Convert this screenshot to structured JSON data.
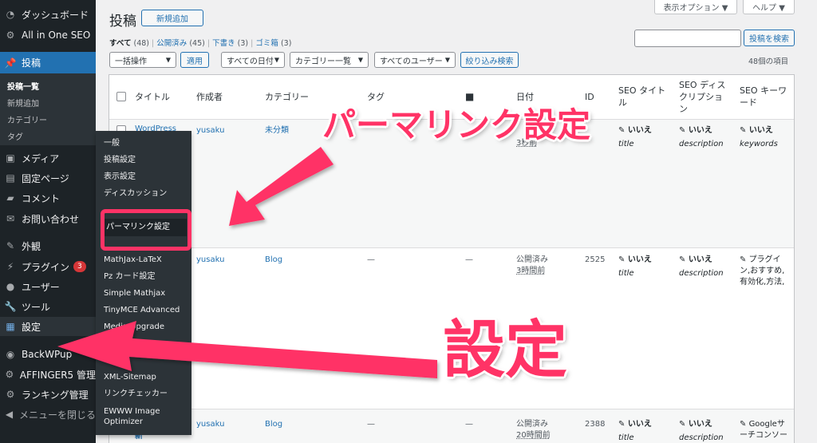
{
  "sidebar": {
    "dashboard": "ダッシュボード",
    "aioseo": "All in One SEO",
    "posts": "投稿",
    "posts_sub": [
      "投稿一覧",
      "新規追加",
      "カテゴリー",
      "タグ"
    ],
    "media": "メディア",
    "pages": "固定ページ",
    "comments": "コメント",
    "contact": "お問い合わせ",
    "appearance": "外観",
    "plugins": "プラグイン",
    "plugins_badge": "3",
    "users": "ユーザー",
    "tools": "ツール",
    "settings": "設定",
    "backwpup": "BackWPup",
    "affinger": "AFFINGER5 管理",
    "ranking": "ランキング管理",
    "collapse": "メニューを閉じる"
  },
  "flyout": {
    "items": [
      "一般",
      "投稿設定",
      "表示設定",
      "ディスカッション",
      "パーマリンク設定",
      "MathJax-LaTeX",
      "Pz カード設定",
      "Simple Mathjax",
      "TinyMCE Advanced",
      "Media Upgrade",
      "",
      "XML-Sitemap",
      "リンクチェッカー",
      "EWWW Image",
      "Optimizer"
    ]
  },
  "header": {
    "title": "投稿",
    "add_new": "新規追加",
    "screen_options": "表示オプション ▼",
    "help": "ヘルプ ▼",
    "filters": {
      "all": "すべて",
      "all_count": "(48)",
      "published": "公開済み",
      "published_count": "(45)",
      "draft": "下書き",
      "draft_count": "(3)",
      "trash": "ゴミ箱",
      "trash_count": "(3)"
    },
    "search_button": "投稿を検索",
    "search_value": "",
    "bulk_action": "一括操作",
    "apply": "適用",
    "date_filter": "すべての日付",
    "category_filter": "カテゴリー一覧",
    "user_filter": "すべてのユーザー",
    "filter_button": "絞り込み検索",
    "item_count": "48個の項目"
  },
  "table": {
    "headers": {
      "title": "タイトル",
      "author": "作成者",
      "categories": "カテゴリー",
      "tags": "タグ",
      "date": "日付",
      "id": "ID",
      "seo_title_1": "SEO タイト",
      "seo_title_2": "ル",
      "seo_desc_1": "SEO ディス",
      "seo_desc_2": "クリプショ",
      "seo_desc_3": "ン",
      "seo_kw_1": "SEO キーワ",
      "seo_kw_2": "ード"
    },
    "rows": [
      {
        "title": "WordPress",
        "author": "yusaku",
        "category": "未分類",
        "date_line2": "3秒前",
        "seo_title": "いいえ",
        "seo_title_sub": "title",
        "seo_desc": "いいえ",
        "seo_desc_sub": "description",
        "seo_kw": "いいえ",
        "seo_kw_sub": "keywords"
      },
      {
        "author": "yusaku",
        "category": "Blog",
        "tags": "—",
        "comments": "—",
        "date_line1": "公開済み",
        "date_line2": "3時間前",
        "id": "2525",
        "seo_title": "いいえ",
        "seo_title_sub": "title",
        "seo_desc": "いいえ",
        "seo_desc_sub": "description",
        "seo_kw_1": "プラグイ",
        "seo_kw_2": "ン,おすすめ,",
        "seo_kw_3": "有効化,方法,"
      },
      {
        "title": "新",
        "author": "yusaku",
        "category": "Blog",
        "tags": "—",
        "comments": "—",
        "date_line1": "公開済み",
        "date_line2": "20時間前",
        "id": "2388",
        "seo_title": "いいえ",
        "seo_title_sub": "title",
        "seo_desc": "いいえ",
        "seo_desc_sub": "description",
        "seo_kw_1": "Googleサ",
        "seo_kw_2": "ーチコンソー"
      }
    ]
  },
  "annotations": {
    "permalink": "パーマリンク設定",
    "settings": "設定",
    "color": "#ff3366"
  }
}
